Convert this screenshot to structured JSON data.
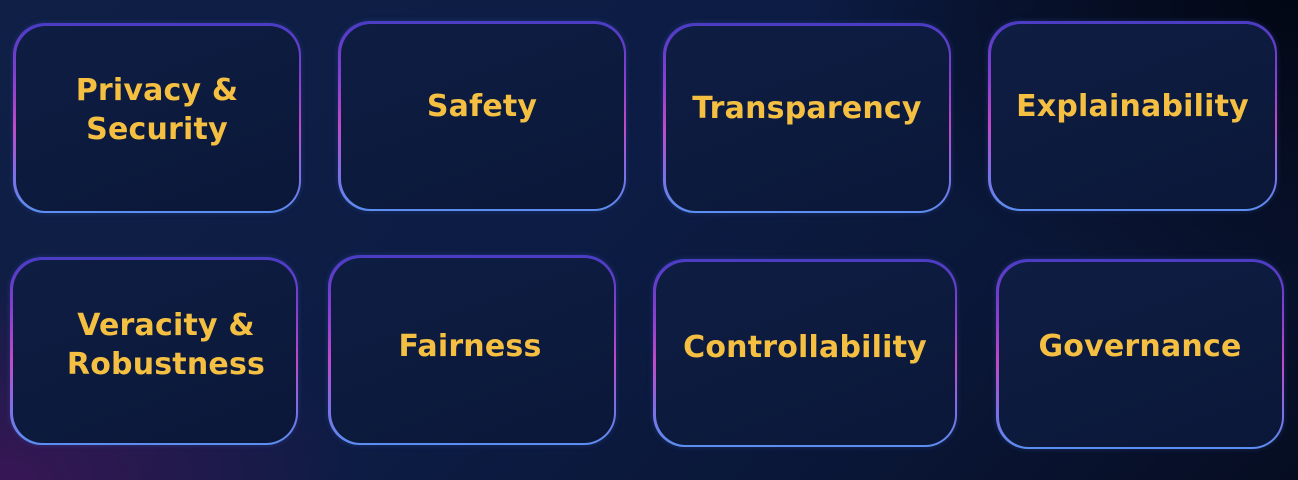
{
  "pillars": {
    "privacy_security": "Privacy &\nSecurity",
    "safety": "Safety",
    "transparency": "Transparency",
    "explainability": "Explainability",
    "veracity_robustness": "Veracity &\nRobustness",
    "fairness": "Fairness",
    "controllability": "Controllability",
    "governance": "Governance"
  },
  "colors": {
    "label": "#f5c042",
    "card_fill": "#0c1a3d",
    "border_top": "#4a3cc4",
    "border_mid": "#c04ac8",
    "border_bottom": "#5b8ef0"
  }
}
